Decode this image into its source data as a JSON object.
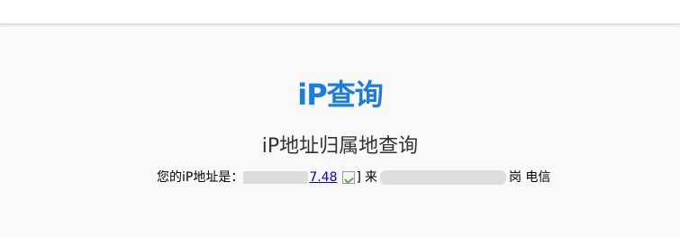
{
  "header": {},
  "logo": {
    "ip_text": "iP",
    "query_text": "查询",
    "colors": {
      "accent": "#1a7de3"
    }
  },
  "page": {
    "subtitle": "iP地址归属地查询",
    "ip_label": "您的iP地址是：",
    "ip_value_visible": "7.48",
    "image_alt": "]",
    "source_prefix": "来",
    "isp_suffix": "岗 电信"
  }
}
